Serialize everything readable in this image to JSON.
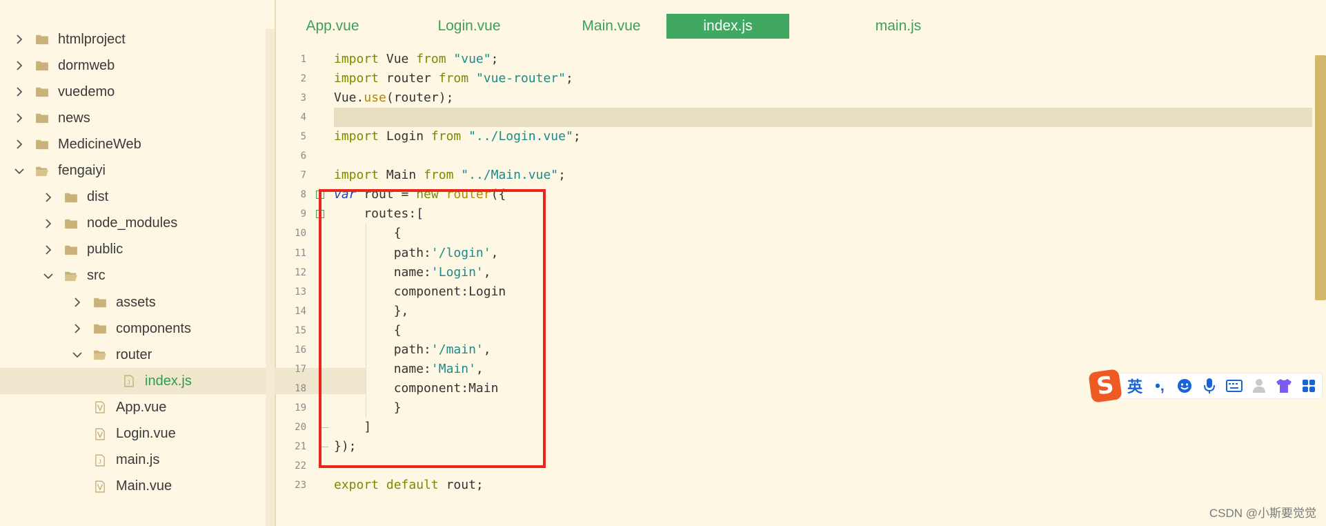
{
  "sidebar": {
    "items": [
      {
        "label": "htmlproject",
        "type": "folder",
        "expanded": false
      },
      {
        "label": "dormweb",
        "type": "folder",
        "expanded": false
      },
      {
        "label": "vuedemo",
        "type": "folder",
        "expanded": false
      },
      {
        "label": "news",
        "type": "folder",
        "expanded": false
      },
      {
        "label": "MedicineWeb",
        "type": "folder",
        "expanded": false
      },
      {
        "label": "fengaiyi",
        "type": "folder",
        "expanded": true
      },
      {
        "label": "dist",
        "type": "folder",
        "expanded": false
      },
      {
        "label": "node_modules",
        "type": "folder",
        "expanded": false
      },
      {
        "label": "public",
        "type": "folder",
        "expanded": false
      },
      {
        "label": "src",
        "type": "folder",
        "expanded": true
      },
      {
        "label": "assets",
        "type": "folder",
        "expanded": false
      },
      {
        "label": "components",
        "type": "folder",
        "expanded": false
      },
      {
        "label": "router",
        "type": "folder",
        "expanded": true
      },
      {
        "label": "index.js",
        "type": "file-js",
        "selected": true
      },
      {
        "label": "App.vue",
        "type": "file-vue"
      },
      {
        "label": "Login.vue",
        "type": "file-vue"
      },
      {
        "label": "main.js",
        "type": "file-js"
      },
      {
        "label": "Main.vue",
        "type": "file-vue"
      }
    ]
  },
  "tabs": [
    {
      "label": "App.vue",
      "active": false
    },
    {
      "label": "Login.vue",
      "active": false
    },
    {
      "label": "Main.vue",
      "active": false
    },
    {
      "label": "index.js",
      "active": true
    },
    {
      "label": "main.js",
      "active": false
    }
  ],
  "editor": {
    "current_line": 4,
    "lines": [
      {
        "n": "1",
        "tokens": [
          [
            "kw",
            "import"
          ],
          [
            "p",
            " Vue "
          ],
          [
            "kw",
            "from"
          ],
          [
            "p",
            " "
          ],
          [
            "str",
            "\"vue\""
          ],
          [
            "p",
            ";"
          ]
        ]
      },
      {
        "n": "2",
        "tokens": [
          [
            "kw",
            "import"
          ],
          [
            "p",
            " router "
          ],
          [
            "kw",
            "from"
          ],
          [
            "p",
            " "
          ],
          [
            "str",
            "\"vue-router\""
          ],
          [
            "p",
            ";"
          ]
        ]
      },
      {
        "n": "3",
        "tokens": [
          [
            "p",
            "Vue."
          ],
          [
            "fn",
            "use"
          ],
          [
            "p",
            "(router);"
          ]
        ]
      },
      {
        "n": "4",
        "tokens": []
      },
      {
        "n": "5",
        "tokens": [
          [
            "kw",
            "import"
          ],
          [
            "p",
            " Login "
          ],
          [
            "kw",
            "from"
          ],
          [
            "p",
            " "
          ],
          [
            "str",
            "\"../Login.vue\""
          ],
          [
            "p",
            ";"
          ]
        ]
      },
      {
        "n": "6",
        "tokens": []
      },
      {
        "n": "7",
        "tokens": [
          [
            "kw",
            "import"
          ],
          [
            "p",
            " Main "
          ],
          [
            "kw",
            "from"
          ],
          [
            "p",
            " "
          ],
          [
            "str",
            "\"../Main.vue\""
          ],
          [
            "p",
            ";"
          ]
        ]
      },
      {
        "n": "8",
        "tokens": [
          [
            "var",
            "var"
          ],
          [
            "p",
            " rout = "
          ],
          [
            "kw",
            "new"
          ],
          [
            "p",
            " "
          ],
          [
            "fn",
            "router"
          ],
          [
            "p",
            "({"
          ]
        ]
      },
      {
        "n": "9",
        "tokens": [
          [
            "p",
            "    routes:["
          ]
        ]
      },
      {
        "n": "10",
        "tokens": [
          [
            "p",
            "        {"
          ]
        ]
      },
      {
        "n": "11",
        "tokens": [
          [
            "p",
            "        path:"
          ],
          [
            "str",
            "'/login'"
          ],
          [
            "p",
            ","
          ]
        ]
      },
      {
        "n": "12",
        "tokens": [
          [
            "p",
            "        name:"
          ],
          [
            "str",
            "'Login'"
          ],
          [
            "p",
            ","
          ]
        ]
      },
      {
        "n": "13",
        "tokens": [
          [
            "p",
            "        component:Login"
          ]
        ]
      },
      {
        "n": "14",
        "tokens": [
          [
            "p",
            "        },"
          ]
        ]
      },
      {
        "n": "15",
        "tokens": [
          [
            "p",
            "        {"
          ]
        ]
      },
      {
        "n": "16",
        "tokens": [
          [
            "p",
            "        path:"
          ],
          [
            "str",
            "'/main'"
          ],
          [
            "p",
            ","
          ]
        ]
      },
      {
        "n": "17",
        "tokens": [
          [
            "p",
            "        name:"
          ],
          [
            "str",
            "'Main'"
          ],
          [
            "p",
            ","
          ]
        ]
      },
      {
        "n": "18",
        "tokens": [
          [
            "p",
            "        component:Main"
          ]
        ]
      },
      {
        "n": "19",
        "tokens": [
          [
            "p",
            "        }"
          ]
        ]
      },
      {
        "n": "20",
        "tokens": [
          [
            "p",
            "    ]"
          ]
        ]
      },
      {
        "n": "21",
        "tokens": [
          [
            "p",
            "});"
          ]
        ]
      },
      {
        "n": "22",
        "tokens": []
      },
      {
        "n": "23",
        "tokens": [
          [
            "kw",
            "export"
          ],
          [
            "p",
            " "
          ],
          [
            "kw",
            "default"
          ],
          [
            "p",
            " rout;"
          ]
        ]
      }
    ]
  },
  "ime": {
    "logo": "S",
    "lang_label": "英",
    "punct_label": "•,",
    "icons": [
      "emoji-icon",
      "microphone-icon",
      "keyboard-icon",
      "user-icon",
      "shirt-icon",
      "apps-icon"
    ]
  },
  "watermark": "CSDN @小斯要觉觉",
  "colors": {
    "background": "#fdf7e3",
    "tab_active": "#41a862",
    "tab_text": "#3aa256",
    "highlight_border": "#e8261c",
    "current_line": "#e8dfc3",
    "scrollbar": "#d3b86b"
  }
}
